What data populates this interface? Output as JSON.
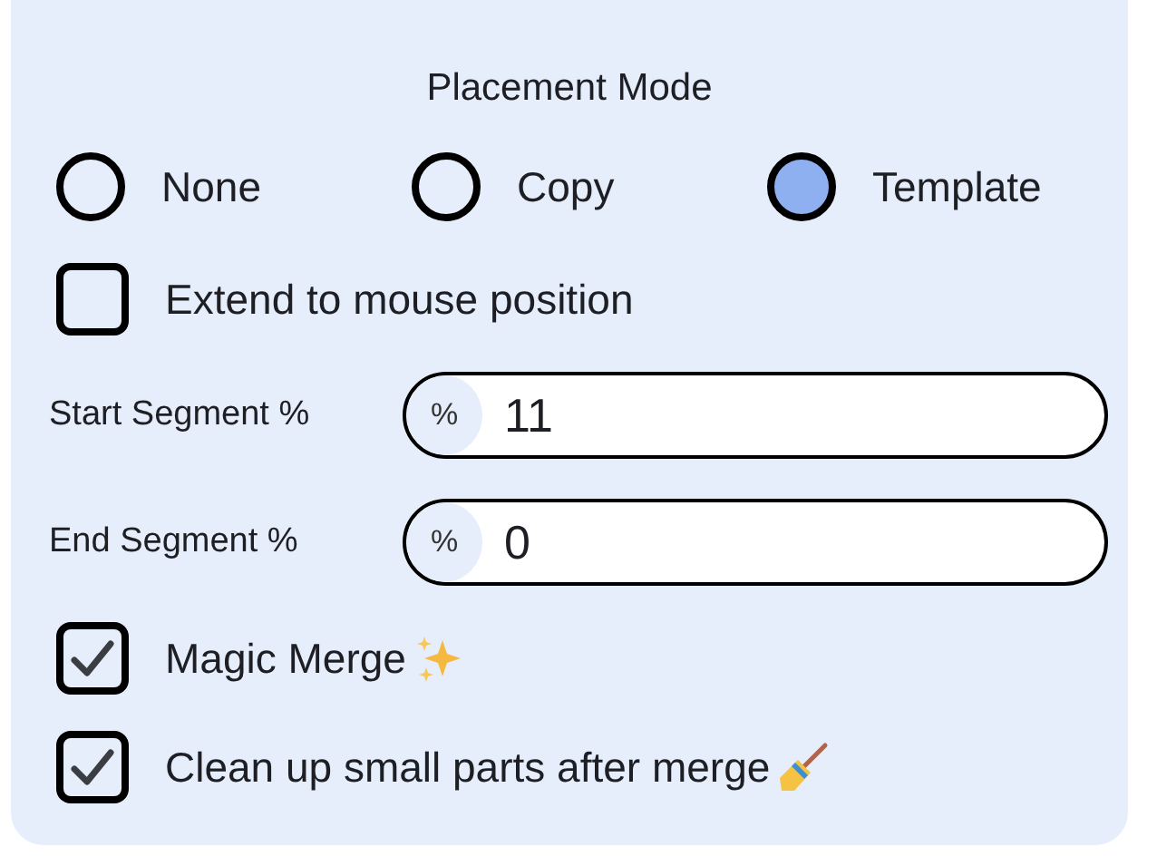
{
  "placement_mode": {
    "title": "Placement Mode",
    "options": [
      {
        "label": "None",
        "selected": false
      },
      {
        "label": "Copy",
        "selected": false
      },
      {
        "label": "Template",
        "selected": true
      }
    ]
  },
  "extend_to_mouse": {
    "label": "Extend to mouse position",
    "checked": false
  },
  "fields": [
    {
      "label": "Start Segment %",
      "prefix": "%",
      "value": "11"
    },
    {
      "label": "End Segment %",
      "prefix": "%",
      "value": "0"
    }
  ],
  "options": [
    {
      "label": "Magic Merge",
      "checked": true,
      "kind": "sparkles"
    },
    {
      "label": "Clean up small parts after merge",
      "checked": true,
      "kind": "broom"
    }
  ]
}
